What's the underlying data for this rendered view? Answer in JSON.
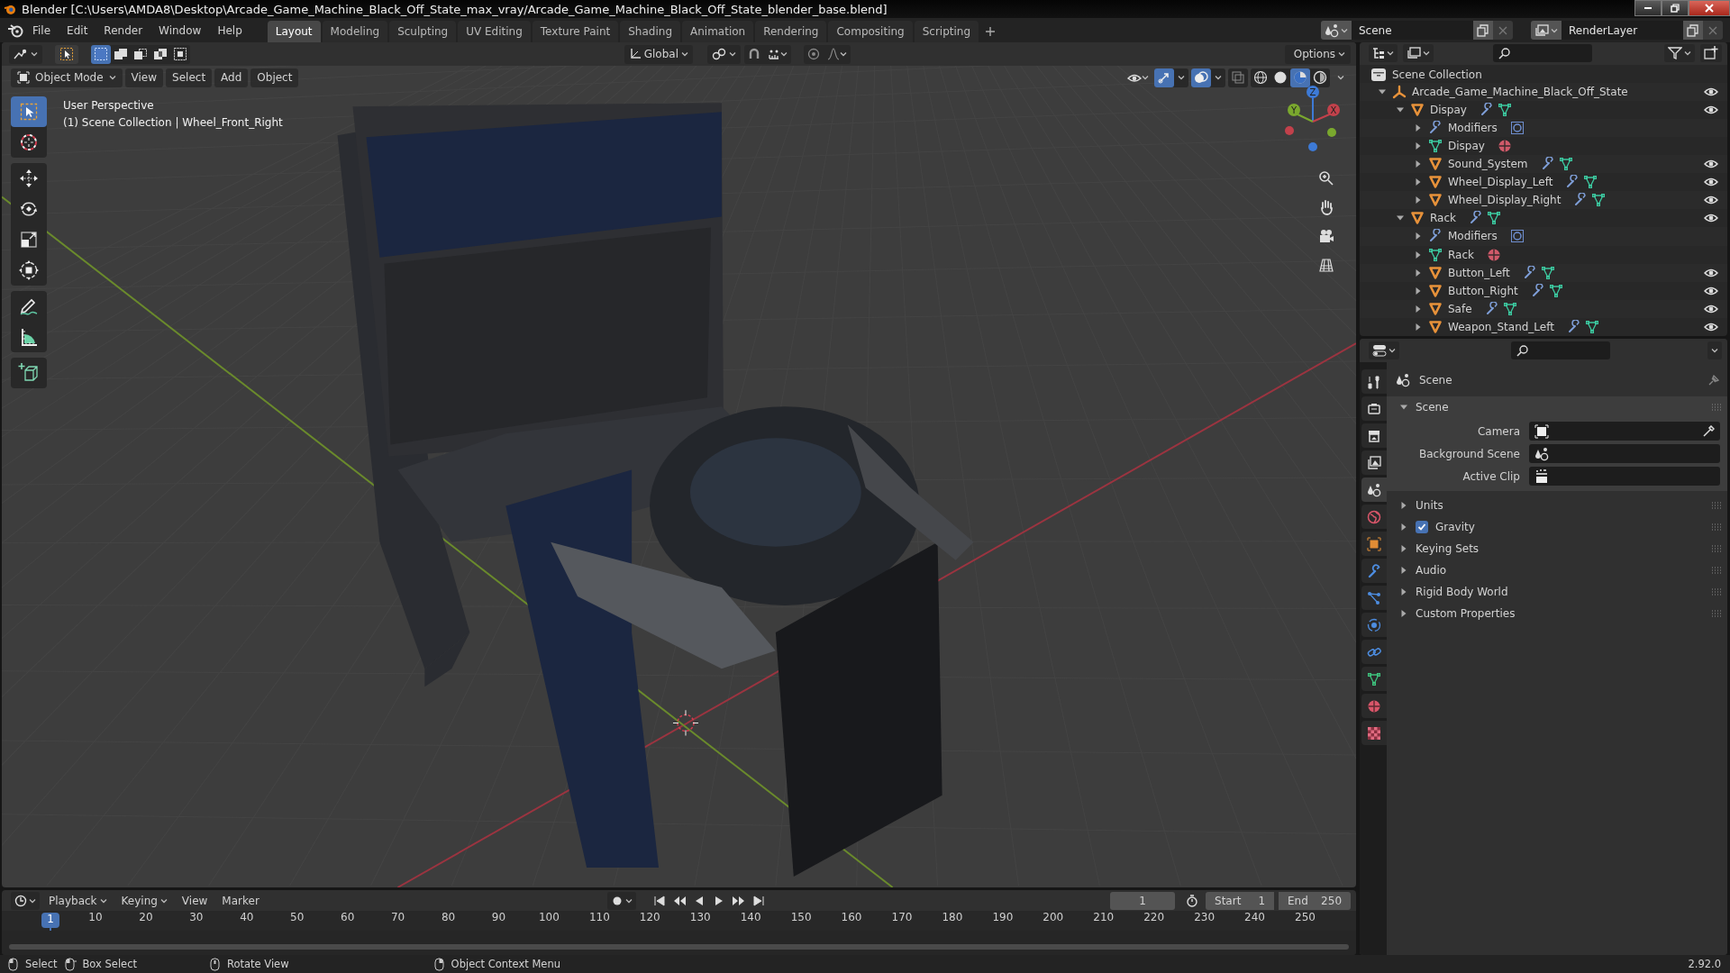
{
  "window": {
    "title": "Blender [C:\\Users\\AMDA8\\Desktop\\Arcade_Game_Machine_Black_Off_State_max_vray/Arcade_Game_Machine_Black_Off_State_blender_base.blend]"
  },
  "menu": [
    "File",
    "Edit",
    "Render",
    "Window",
    "Help"
  ],
  "workspace_tabs": [
    {
      "label": "Layout",
      "selected": true
    },
    {
      "label": "Modeling",
      "selected": false
    },
    {
      "label": "Sculpting",
      "selected": false
    },
    {
      "label": "UV Editing",
      "selected": false
    },
    {
      "label": "Texture Paint",
      "selected": false
    },
    {
      "label": "Shading",
      "selected": false
    },
    {
      "label": "Animation",
      "selected": false
    },
    {
      "label": "Rendering",
      "selected": false
    },
    {
      "label": "Compositing",
      "selected": false
    },
    {
      "label": "Scripting",
      "selected": false
    }
  ],
  "scene_field": {
    "value": "Scene"
  },
  "view_layer_field": {
    "value": "RenderLayer"
  },
  "viewport": {
    "selection_modes": [
      {
        "kind": "set",
        "selected": true
      },
      {
        "kind": "extend",
        "selected": false
      },
      {
        "kind": "subtract",
        "selected": false
      },
      {
        "kind": "difference",
        "selected": false
      },
      {
        "kind": "intersect",
        "selected": false
      }
    ],
    "transform_orientation": "Global",
    "options": "Options",
    "mode": "Object Mode",
    "menus": [
      "View",
      "Select",
      "Add",
      "Object"
    ],
    "toggles": [
      {
        "kind": "gizmos",
        "on": true
      },
      {
        "kind": "overlays",
        "on": true
      },
      {
        "kind": "xray",
        "on": false
      }
    ],
    "shading_modes": [
      {
        "kind": "wireframe",
        "selected": false
      },
      {
        "kind": "solid",
        "selected": false
      },
      {
        "kind": "material",
        "selected": true
      },
      {
        "kind": "rendered",
        "selected": false
      }
    ],
    "toolbar": [
      {
        "tools": [
          {
            "kind": "select",
            "selected": true
          },
          {
            "kind": "cursor",
            "selected": false
          }
        ]
      },
      {
        "tools": [
          {
            "kind": "move",
            "selected": false
          },
          {
            "kind": "rotate",
            "selected": false
          },
          {
            "kind": "scale",
            "selected": false
          },
          {
            "kind": "transform",
            "selected": false
          }
        ]
      },
      {
        "tools": [
          {
            "kind": "annotate",
            "selected": false
          },
          {
            "kind": "measure",
            "selected": false
          }
        ]
      },
      {
        "tools": [
          {
            "kind": "add_cube",
            "selected": false
          }
        ]
      }
    ],
    "overlay_text": [
      "User Perspective",
      "(1) Scene Collection | Wheel_Front_Right"
    ],
    "gizmo_axes": [
      "Z",
      "Y",
      "X"
    ]
  },
  "outliner": {
    "root": "Scene Collection",
    "items": [
      {
        "label": "Arcade_Game_Machine_Black_Off_State",
        "kind": "empty",
        "expanded": true,
        "children": [
          {
            "label": "Dispay",
            "kind": "object",
            "expanded": true,
            "children": [
              {
                "label": "Modifiers",
                "kind": "modifiers",
                "expanded": false
              },
              {
                "label": "Dispay",
                "kind": "mesh",
                "expanded": false
              },
              {
                "label": "Sound_System",
                "kind": "object",
                "expanded": false
              },
              {
                "label": "Wheel_Display_Left",
                "kind": "object",
                "expanded": false
              },
              {
                "label": "Wheel_Display_Right",
                "kind": "object",
                "expanded": false
              }
            ]
          },
          {
            "label": "Rack",
            "kind": "object",
            "expanded": true,
            "children": [
              {
                "label": "Modifiers",
                "kind": "modifiers",
                "expanded": false
              },
              {
                "label": "Rack",
                "kind": "mesh",
                "expanded": false
              },
              {
                "label": "Button_Left",
                "kind": "object",
                "expanded": false
              },
              {
                "label": "Button_Right",
                "kind": "object",
                "expanded": false
              },
              {
                "label": "Safe",
                "kind": "object",
                "expanded": false
              },
              {
                "label": "Weapon_Stand_Left",
                "kind": "object",
                "expanded": false
              }
            ]
          }
        ]
      }
    ]
  },
  "properties": {
    "tabs": [
      {
        "kind": "tool",
        "selected": false
      },
      {
        "kind": "render",
        "selected": false
      },
      {
        "kind": "output",
        "selected": false
      },
      {
        "kind": "view_layer",
        "selected": false
      },
      {
        "kind": "scene",
        "selected": true
      },
      {
        "kind": "world",
        "selected": false
      },
      {
        "kind": "object",
        "selected": false
      },
      {
        "kind": "modifiers",
        "selected": false
      },
      {
        "kind": "particles",
        "selected": false
      },
      {
        "kind": "physics",
        "selected": false
      },
      {
        "kind": "constraints",
        "selected": false
      },
      {
        "kind": "data",
        "selected": false
      },
      {
        "kind": "material",
        "selected": false
      },
      {
        "kind": "texture",
        "selected": false
      }
    ],
    "header": "Scene",
    "panel": {
      "title": "Scene",
      "expanded": true,
      "fields": [
        {
          "label": "Camera",
          "kind": "camera"
        },
        {
          "label": "Background Scene",
          "kind": "scene"
        },
        {
          "label": "Active Clip",
          "kind": "clip"
        }
      ]
    },
    "subpanels": [
      {
        "label": "Units",
        "kind": "plain",
        "expanded": false
      },
      {
        "label": "Gravity",
        "kind": "checkbox",
        "checked": true,
        "expanded": false
      },
      {
        "label": "Keying Sets",
        "kind": "plain",
        "expanded": false
      },
      {
        "label": "Audio",
        "kind": "plain",
        "expanded": false
      },
      {
        "label": "Rigid Body World",
        "kind": "plain",
        "expanded": false
      },
      {
        "label": "Custom Properties",
        "kind": "plain",
        "expanded": false
      }
    ]
  },
  "timeline": {
    "menus": [
      {
        "label": "Playback",
        "dropdown": true
      },
      {
        "label": "Keying",
        "dropdown": true
      },
      {
        "label": "View",
        "dropdown": false
      },
      {
        "label": "Marker",
        "dropdown": false
      }
    ],
    "current_frame": "1",
    "start_label": "Start",
    "start": "1",
    "end_label": "End",
    "end": "250",
    "playhead": "1",
    "ruler": [
      "10",
      "20",
      "30",
      "40",
      "50",
      "60",
      "70",
      "80",
      "90",
      "100",
      "110",
      "120",
      "130",
      "140",
      "150",
      "160",
      "170",
      "180",
      "190",
      "200",
      "210",
      "220",
      "230",
      "240",
      "250"
    ]
  },
  "status_bar": {
    "hints": [
      {
        "kind": "left",
        "label": "Select"
      },
      {
        "kind": "drag",
        "label": "Box Select"
      },
      {
        "kind": "middle",
        "label": "Rotate View"
      },
      {
        "kind": "right",
        "label": "Object Context Menu"
      }
    ],
    "version": "2.92.0"
  }
}
